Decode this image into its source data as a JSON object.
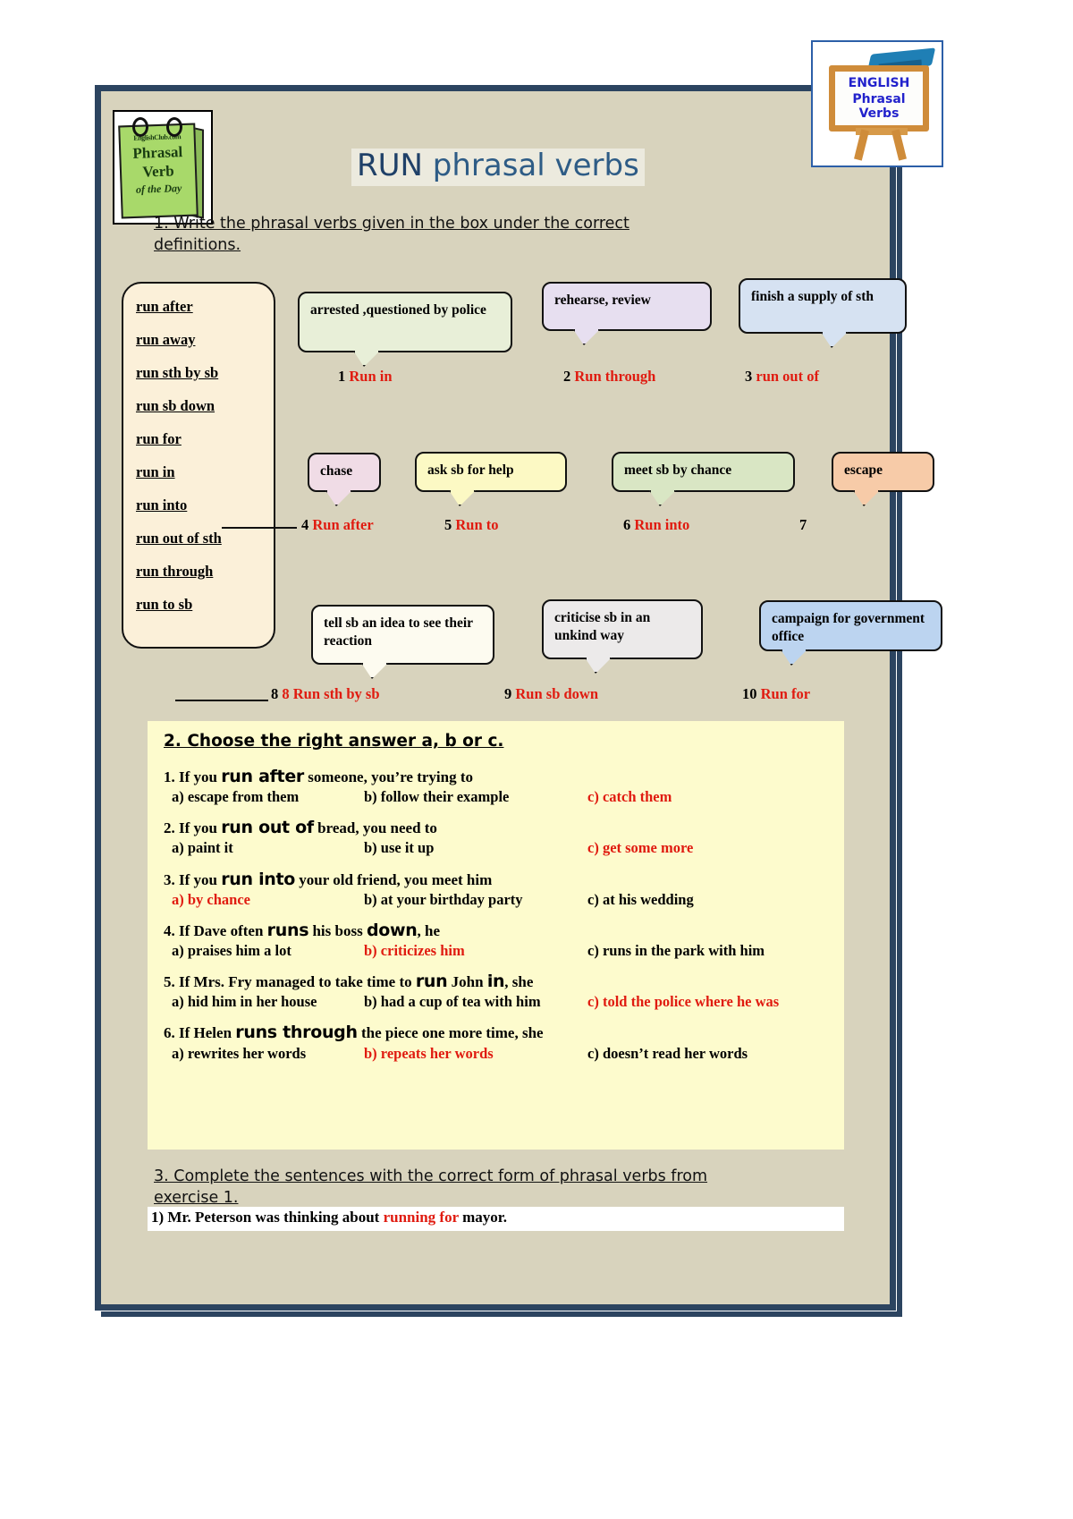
{
  "page": {
    "title_run": "RUN",
    "title_rest": " phrasal verbs",
    "bg_color": "#d8d3bd",
    "frame_color": "#2c4460",
    "accent_red": "#e01b10"
  },
  "badge_left": {
    "site": "EnglishClub.com",
    "line1": "Phrasal",
    "line2": "Verb",
    "line3": "of the Day"
  },
  "logo_right": {
    "line1": "ENGLISH",
    "line2": "Phrasal Verbs"
  },
  "exercise1": {
    "instruction_part1": "1. Write the phrasal verbs given in the box under the correct ",
    "instruction_part2": "definitions.",
    "wordbank": [
      " run after",
      " run away",
      " run sth by sb",
      " run sb down",
      " run for",
      " run in",
      " run into",
      " run out of sth",
      " run through",
      " run to sb"
    ],
    "bubbles": [
      {
        "text": "arrested ,questioned by police",
        "color": "#e8efd8"
      },
      {
        "text": "rehearse, review",
        "color": "#e7dff0"
      },
      {
        "text": "finish a supply of sth",
        "color": "#d6e2f2"
      },
      {
        "text": "chase",
        "color": "#f0dce6"
      },
      {
        "text": "ask sb for help",
        "color": "#fcf9c4"
      },
      {
        "text": "meet sb by chance",
        "color": "#d9e6c4"
      },
      {
        "text": "escape",
        "color": "#f7cba8"
      },
      {
        "text": "tell sb an idea to see their reaction",
        "color": "#fdfbf0"
      },
      {
        "text": "criticise sb in an unkind way",
        "color": "#eceaea"
      },
      {
        "text": "campaign for government office",
        "color": "#bcd4f0"
      }
    ],
    "answers": [
      {
        "num": "1",
        "value": "Run in"
      },
      {
        "num": "2",
        "value": "Run through"
      },
      {
        "num": "3",
        "value": "run out of"
      },
      {
        "num": "4",
        "value": "Run after"
      },
      {
        "num": "5",
        "value": "Run to"
      },
      {
        "num": "6",
        "value": "Run into"
      },
      {
        "num": "7",
        "value": ""
      },
      {
        "num": "8",
        "value": "8 Run sth by sb"
      },
      {
        "num": "9",
        "value": "Run sb down"
      },
      {
        "num": "10",
        "value": "Run for"
      }
    ]
  },
  "exercise2": {
    "heading": "2. Choose the right answer a, b or c.",
    "questions": [
      {
        "stem_pre": "1. If you ",
        "stem_pv": "run after",
        "stem_post": " someone, you’re trying to",
        "a": "a) escape from them",
        "b": "b) follow their example",
        "c": "c) catch them",
        "correct": "c"
      },
      {
        "stem_pre": "2. If you ",
        "stem_pv": "run out of",
        "stem_post": " bread, you need to",
        "a": "a) paint it",
        "b": "b) use it up",
        "c": "c) get some more",
        "correct": "c"
      },
      {
        "stem_pre": "3. If you ",
        "stem_pv": "run into",
        "stem_post": " your old friend, you meet him",
        "a": "a) by chance",
        "b": "b) at your birthday party",
        "c": "c) at his wedding",
        "correct": "a"
      },
      {
        "stem_pre": "4. If Dave often ",
        "stem_pv": "runs",
        "stem_mid": " his boss ",
        "stem_pv2": "down",
        "stem_post": ", he",
        "a": "a) praises him a lot",
        "b": "b) criticizes him",
        "c": "c) runs in the park with him",
        "correct": "b"
      },
      {
        "stem_pre": "5. If Mrs. Fry managed to take time to ",
        "stem_pv": "run",
        "stem_mid": " John ",
        "stem_pv2": "in",
        "stem_post": ", she",
        "a": "a) hid him in her house",
        "b": "b) had a cup of tea with him",
        "c": "c) told the police where he was",
        "correct": "c"
      },
      {
        "stem_pre": "6. If Helen ",
        "stem_pv": "runs through",
        "stem_post": " the piece one more time, she",
        "a": "a) rewrites her words",
        "b": "b) repeats her words",
        "c": "c) doesn’t read her words",
        "correct": "b"
      }
    ]
  },
  "exercise3": {
    "instruction_part1": "3. Complete the sentences with the correct form of phrasal verbs from ",
    "instruction_part2": "exercise 1. ",
    "sentence_pre": "1) Mr. Peterson was thinking about ",
    "sentence_answer": "running for",
    "sentence_post": " mayor."
  }
}
